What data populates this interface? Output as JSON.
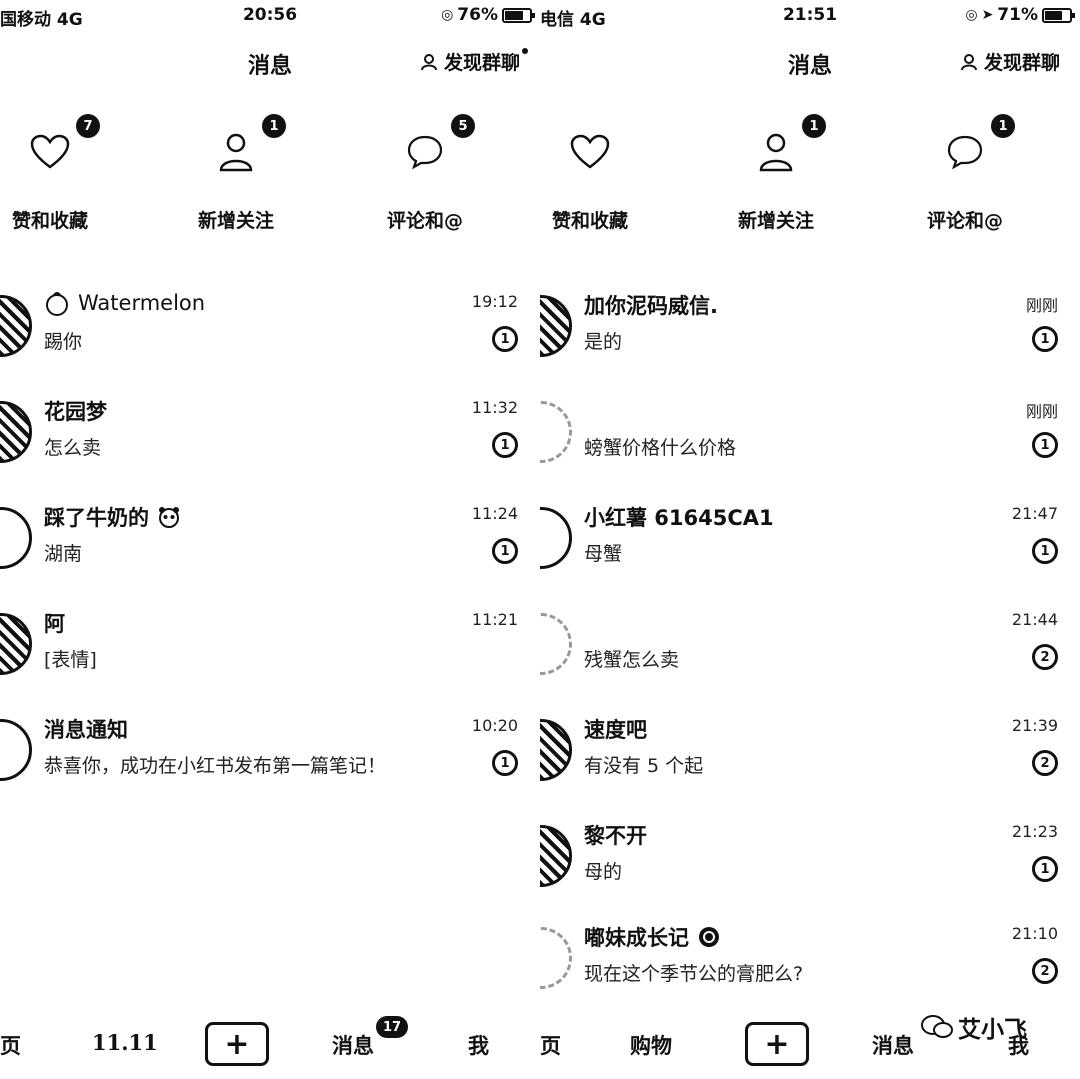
{
  "left": {
    "status": {
      "carrier": "国移动 4G",
      "time": "20:56",
      "battery": "76%",
      "battery_level": 0.76
    },
    "header": {
      "title": "消息",
      "discover": "发现群聊"
    },
    "quick": [
      {
        "label": "赞和收藏",
        "badge": "7",
        "icon": "heart-icon"
      },
      {
        "label": "新增关注",
        "badge": "1",
        "icon": "person-icon"
      },
      {
        "label": "评论和@",
        "badge": "5",
        "icon": "comment-icon"
      }
    ],
    "messages": [
      {
        "name": "Watermelon",
        "preview": "踢你",
        "time": "19:12",
        "badge": "1",
        "name_icon": "round-face-icon"
      },
      {
        "name": "花园梦",
        "preview": "怎么卖",
        "time": "11:32",
        "badge": "1"
      },
      {
        "name": "踩了牛奶的",
        "preview": "湖南",
        "time": "11:24",
        "badge": "1",
        "name_icon": "panda-icon"
      },
      {
        "name": "阿",
        "preview": "[表情]",
        "time": "11:21",
        "badge": ""
      },
      {
        "name": "消息通知",
        "preview": "恭喜你，成功在小红书发布第一篇笔记！",
        "time": "10:20",
        "badge": "1"
      }
    ],
    "tabs": {
      "home": "页",
      "promo": "11.11",
      "plus": "+",
      "messages": "消息",
      "messages_badge": "17",
      "me": "我"
    }
  },
  "right": {
    "status": {
      "carrier": "电信 4G",
      "time": "21:51",
      "battery": "71%",
      "battery_level": 0.71
    },
    "header": {
      "title": "消息",
      "discover": "发现群聊"
    },
    "quick": [
      {
        "label": "赞和收藏",
        "badge": "",
        "icon": "heart-icon"
      },
      {
        "label": "新增关注",
        "badge": "1",
        "icon": "person-icon"
      },
      {
        "label": "评论和@",
        "badge": "1",
        "icon": "comment-icon"
      }
    ],
    "messages": [
      {
        "name": "加你泥码威信.",
        "preview": "是的",
        "time": "刚刚",
        "badge": "1"
      },
      {
        "name": "",
        "preview": "螃蟹价格什么价格",
        "time": "刚刚",
        "badge": "1"
      },
      {
        "name": "小红薯 61645CA1",
        "preview": "母蟹",
        "time": "21:47",
        "badge": "1"
      },
      {
        "name": "",
        "preview": "残蟹怎么卖",
        "time": "21:44",
        "badge": "2"
      },
      {
        "name": "速度吧",
        "preview": "有没有 5 个起",
        "time": "21:39",
        "badge": "2"
      },
      {
        "name": "黎不开",
        "preview": "母的",
        "time": "21:23",
        "badge": "1"
      },
      {
        "name": "嘟妹成长记",
        "preview": "现在这个季节公的膏肥么?",
        "time": "21:10",
        "badge": "2",
        "name_icon": "badge-icon"
      }
    ],
    "tabs": {
      "home": "页",
      "shop": "购物",
      "plus": "+",
      "messages": "消息",
      "me": "我"
    },
    "watermark": "艾小飞"
  }
}
